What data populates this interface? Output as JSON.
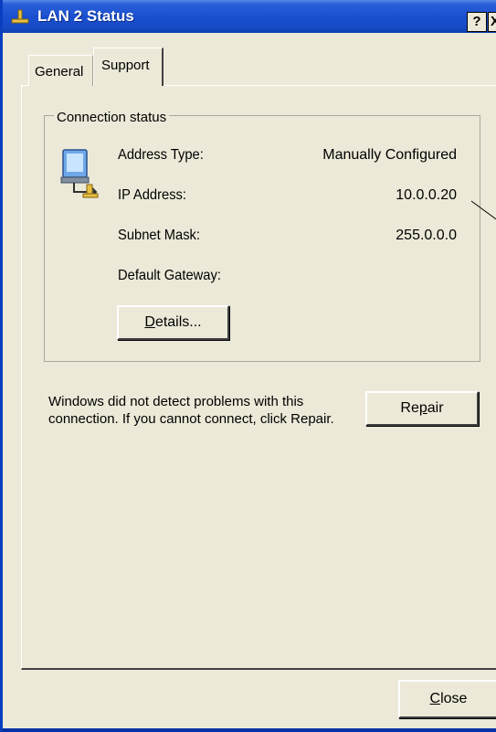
{
  "window": {
    "title": "LAN 2 Status",
    "help_label": "?",
    "close_glyph": "X"
  },
  "tabs": [
    {
      "label": "General",
      "active": false
    },
    {
      "label": "Support",
      "active": true
    }
  ],
  "connection_status": {
    "group_label": "Connection status",
    "icon": "network-connection-icon",
    "fields": [
      {
        "label": "Address Type:",
        "value": "Manually Configured"
      },
      {
        "label": "IP Address:",
        "value": "10.0.0.20"
      },
      {
        "label": "Subnet Mask:",
        "value": "255.0.0.0"
      },
      {
        "label": "Default Gateway:",
        "value": ""
      }
    ],
    "details_button": {
      "label_prefix": "",
      "mnemonic": "D",
      "label_rest": "etails..."
    }
  },
  "repair_section": {
    "message": "Windows did not detect problems with this connection. If you cannot connect, click Repair.",
    "repair_button": {
      "label_prefix": "Re",
      "mnemonic": "p",
      "label_rest": "air"
    }
  },
  "footer": {
    "close_button": {
      "label_prefix": "",
      "mnemonic": "C",
      "label_rest": "lose"
    }
  },
  "colors": {
    "titlebar": "#1a4fd0",
    "dialog_bg": "#ece9d8",
    "desktop": "#3a6ea5"
  }
}
